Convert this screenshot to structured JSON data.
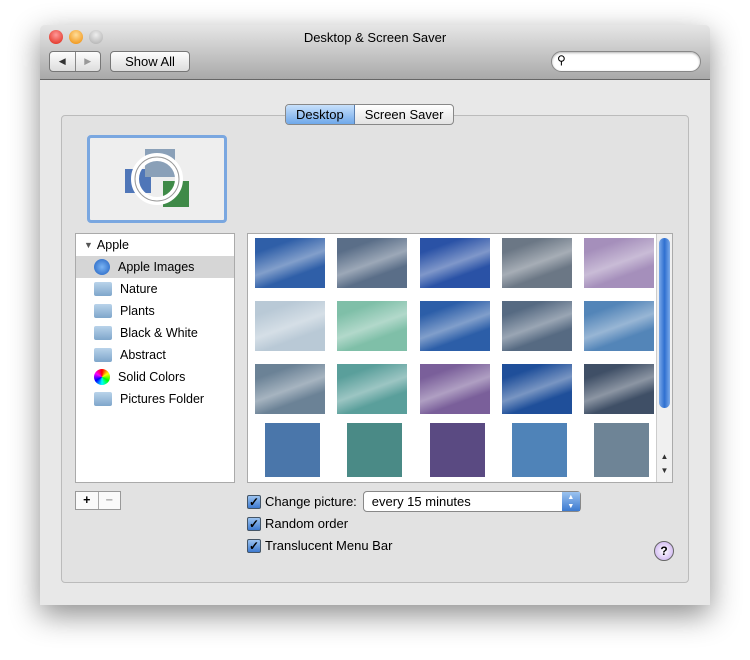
{
  "window": {
    "title": "Desktop & Screen Saver"
  },
  "toolbar": {
    "back": "◀",
    "forward": "▶",
    "show_all": "Show All",
    "search_placeholder": ""
  },
  "tabs": [
    {
      "label": "Desktop",
      "selected": true
    },
    {
      "label": "Screen Saver",
      "selected": false
    }
  ],
  "sources": {
    "group": "Apple",
    "items": [
      {
        "label": "Apple Images",
        "icon": "apple-icon",
        "selected": true
      },
      {
        "label": "Nature",
        "icon": "folder-icon"
      },
      {
        "label": "Plants",
        "icon": "folder-icon"
      },
      {
        "label": "Black & White",
        "icon": "folder-icon"
      },
      {
        "label": "Abstract",
        "icon": "folder-icon"
      },
      {
        "label": "Solid Colors",
        "icon": "color-wheel-icon"
      },
      {
        "label": "Pictures Folder",
        "icon": "pictures-folder-icon"
      }
    ]
  },
  "thumbnails": [
    [
      "#2f5fa8",
      "#5a6e88",
      "#2a52a6",
      "#6b7785",
      "#a58fbb"
    ],
    [
      "#b9c9d6",
      "#7fbfa8",
      "#2c5ea8",
      "#566a82",
      "#5385b8"
    ],
    [
      "#6b8296",
      "#5a9f9b",
      "#7a5f9a",
      "#1f4f9a",
      "#3f4f66"
    ]
  ],
  "solid_colors": [
    "#4a76aa",
    "#4a8a86",
    "#5a4a82",
    "#4f83b8",
    "#6e8496"
  ],
  "options": {
    "change_picture": {
      "label": "Change picture:",
      "checked": true,
      "value": "every 15 minutes"
    },
    "random_order": {
      "label": "Random order",
      "checked": true
    },
    "translucent_menu_bar": {
      "label": "Translucent Menu Bar",
      "checked": true
    }
  },
  "buttons": {
    "add": "+",
    "remove": "−",
    "help": "?"
  }
}
